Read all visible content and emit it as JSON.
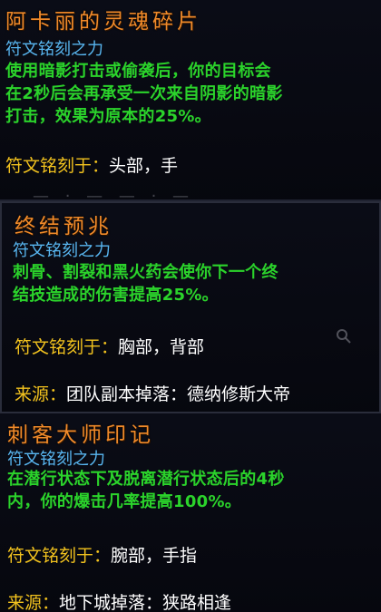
{
  "tooltips": [
    {
      "title": "阿卡丽的灵魂碎片",
      "subtitle": "符文铭刻之力",
      "description": "使用暗影打击或偷袭后，你的目标会\n在2秒后会再承受一次来自阴影的暗影\n打击，效果为原本的25%。",
      "inscribed_label": "符文铭刻于：",
      "inscribed_value": "头部，手"
    },
    {
      "title": "终结预兆",
      "subtitle": "符文铭刻之力",
      "description": "刺骨、割裂和黑火药会使你下一个终\n结技造成的伤害提高25%。",
      "inscribed_label": "符文铭刻于：",
      "inscribed_value": "胸部，背部",
      "source_label": "来源：",
      "source_value": "团队副本掉落：德纳修斯大帝"
    },
    {
      "title": "刺客大师印记",
      "subtitle": "符文铭刻之力",
      "description": "在潜行状态下及脱离潜行状态后的4秒\n内，你的爆击几率提高100%。",
      "inscribed_label": "符文铭刻于：",
      "inscribed_value": "腕部，手指",
      "source_label": "来源：",
      "source_value": "地下城掉落：狭路相逢"
    }
  ],
  "colors": {
    "title": "#f08a2a",
    "subtitle": "#58b6f0",
    "description": "#2bd32b",
    "label": "#f2c21e",
    "value": "#ffffff"
  },
  "icons": {
    "background_search": "search-icon"
  }
}
